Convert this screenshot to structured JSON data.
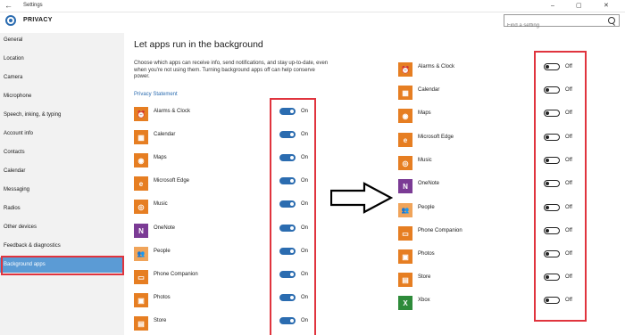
{
  "window": {
    "title": "Settings",
    "back": "←",
    "minimize": "–",
    "maximize": "▢",
    "close": "✕"
  },
  "header": {
    "section": "PRIVACY",
    "gear": "gear-icon"
  },
  "search": {
    "placeholder": "Find a setting"
  },
  "sidebar": {
    "items": [
      {
        "label": "General"
      },
      {
        "label": "Location"
      },
      {
        "label": "Camera"
      },
      {
        "label": "Microphone"
      },
      {
        "label": "Speech, inking, & typing"
      },
      {
        "label": "Account info"
      },
      {
        "label": "Contacts"
      },
      {
        "label": "Calendar"
      },
      {
        "label": "Messaging"
      },
      {
        "label": "Radios"
      },
      {
        "label": "Other devices"
      },
      {
        "label": "Feedback & diagnostics"
      },
      {
        "label": "Background apps",
        "active": true
      }
    ]
  },
  "main": {
    "title": "Let apps run in the background",
    "description": "Choose which apps can receive info, send notifications, and stay up-to-date, even when you're not using them. Turning background apps off can help conserve power.",
    "privacy_link": "Privacy Statement"
  },
  "left_apps": [
    {
      "name": "Alarms & Clock",
      "icon": "alarm-clock-icon",
      "color": "#e67e22",
      "glyph": "⏰",
      "state": "On"
    },
    {
      "name": "Calendar",
      "icon": "calendar-icon",
      "color": "#e67e22",
      "glyph": "▦",
      "state": "On"
    },
    {
      "name": "Maps",
      "icon": "camera-icon",
      "color": "#e67e22",
      "glyph": "◉",
      "state": "On"
    },
    {
      "name": "Microsoft Edge",
      "icon": "edge-icon",
      "color": "#e67e22",
      "glyph": "e",
      "state": "On"
    },
    {
      "name": "Music",
      "icon": "music-icon",
      "color": "#e67e22",
      "glyph": "◎",
      "state": "On"
    },
    {
      "name": "OneNote",
      "icon": "onenote-icon",
      "color": "#7b3b95",
      "glyph": "N",
      "state": "On"
    },
    {
      "name": "People",
      "icon": "people-icon",
      "color": "#f0a45a",
      "glyph": "👥",
      "state": "On"
    },
    {
      "name": "Phone Companion",
      "icon": "phone-icon",
      "color": "#e67e22",
      "glyph": "▭",
      "state": "On"
    },
    {
      "name": "Photos",
      "icon": "photos-icon",
      "color": "#e67e22",
      "glyph": "▣",
      "state": "On"
    },
    {
      "name": "Store",
      "icon": "store-icon",
      "color": "#e67e22",
      "glyph": "▤",
      "state": "On"
    }
  ],
  "right_apps": [
    {
      "name": "Alarms & Clock",
      "icon": "alarm-clock-icon",
      "color": "#e67e22",
      "glyph": "⏰",
      "state": "Off"
    },
    {
      "name": "Calendar",
      "icon": "calendar-icon",
      "color": "#e67e22",
      "glyph": "▦",
      "state": "Off"
    },
    {
      "name": "Maps",
      "icon": "camera-icon",
      "color": "#e67e22",
      "glyph": "◉",
      "state": "Off"
    },
    {
      "name": "Microsoft Edge",
      "icon": "edge-icon",
      "color": "#e67e22",
      "glyph": "e",
      "state": "Off"
    },
    {
      "name": "Music",
      "icon": "music-icon",
      "color": "#e67e22",
      "glyph": "◎",
      "state": "Off"
    },
    {
      "name": "OneNote",
      "icon": "onenote-icon",
      "color": "#7b3b95",
      "glyph": "N",
      "state": "Off"
    },
    {
      "name": "People",
      "icon": "people-icon",
      "color": "#f0a45a",
      "glyph": "👥",
      "state": "Off"
    },
    {
      "name": "Phone Companion",
      "icon": "phone-icon",
      "color": "#e67e22",
      "glyph": "▭",
      "state": "Off"
    },
    {
      "name": "Photos",
      "icon": "photos-icon",
      "color": "#e67e22",
      "glyph": "▣",
      "state": "Off"
    },
    {
      "name": "Store",
      "icon": "store-icon",
      "color": "#e67e22",
      "glyph": "▤",
      "state": "Off"
    },
    {
      "name": "Xbox",
      "icon": "xbox-icon",
      "color": "#2e8b3a",
      "glyph": "X",
      "state": "Off"
    }
  ],
  "colors": {
    "accent": "#2b6cb0",
    "highlight": "#e0343e",
    "active_nav": "#5b9bd5"
  }
}
